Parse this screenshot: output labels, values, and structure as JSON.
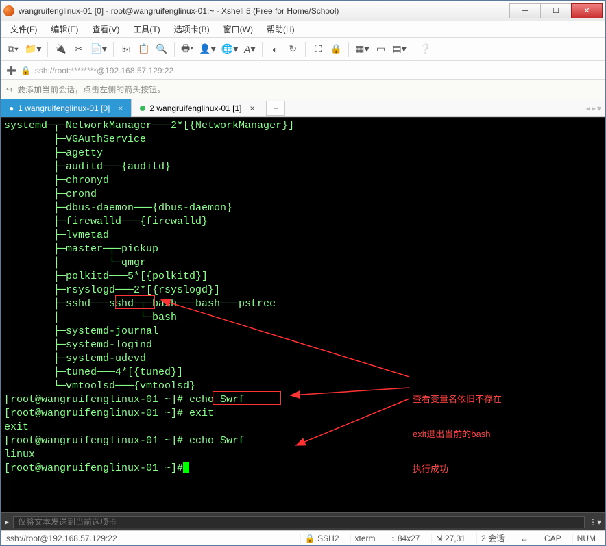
{
  "titlebar": {
    "title": "wangruifenglinux-01 [0] - root@wangruifenglinux-01:~ - Xshell 5 (Free for Home/School)"
  },
  "menu": {
    "file": "文件(F)",
    "edit": "编辑(E)",
    "view": "查看(V)",
    "tools": "工具(T)",
    "tab": "选项卡(B)",
    "window": "窗口(W)",
    "help": "帮助(H)"
  },
  "address": {
    "text": "ssh://root:********@192.168.57.129:22"
  },
  "hint": {
    "text": "要添加当前会话，点击左侧的箭头按钮。"
  },
  "tabs": {
    "items": [
      {
        "label": "1 wangruifenglinux-01 [0]",
        "active": true
      },
      {
        "label": "2 wangruifenglinux-01 [1]",
        "active": false
      }
    ],
    "add": "+"
  },
  "terminal": {
    "lines": [
      "systemd─┬─NetworkManager───2*[{NetworkManager}]",
      "        ├─VGAuthService",
      "        ├─agetty",
      "        ├─auditd───{auditd}",
      "        ├─chronyd",
      "        ├─crond",
      "        ├─dbus-daemon───{dbus-daemon}",
      "        ├─firewalld───{firewalld}",
      "        ├─lvmetad",
      "        ├─master─┬─pickup",
      "        │        └─qmgr",
      "        ├─polkitd───5*[{polkitd}]",
      "        ├─rsyslogd───2*[{rsyslogd}]",
      "        ├─sshd───sshd─┬─bash───bash───pstree",
      "        │             └─bash",
      "        ├─systemd-journal",
      "        ├─systemd-logind",
      "        ├─systemd-udevd",
      "        ├─tuned───4*[{tuned}]",
      "        └─vmtoolsd───{vmtoolsd}",
      "[root@wangruifenglinux-01 ~]# echo $wrf",
      "",
      "[root@wangruifenglinux-01 ~]# exit",
      "exit",
      "[root@wangruifenglinux-01 ~]# echo $wrf",
      "linux",
      "[root@wangruifenglinux-01 ~]# "
    ],
    "annotation": {
      "line1": "查看变量名依旧不存在",
      "line2": "exit退出当前的bash",
      "line3": "执行成功"
    }
  },
  "sendbar": {
    "placeholder": "仅将文本发送到当前选项卡"
  },
  "status": {
    "path": "ssh://root@192.168.57.129:22",
    "ssh": "SSH2",
    "term": "xterm",
    "size": "84x27",
    "pos": "27,31",
    "sessions": "2 会话",
    "cap": "CAP",
    "num": "NUM"
  }
}
